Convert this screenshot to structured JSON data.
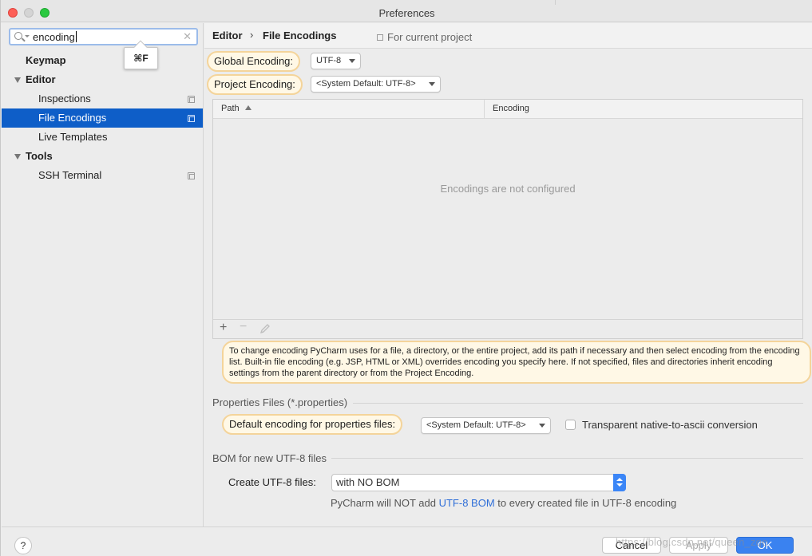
{
  "window": {
    "title": "Preferences"
  },
  "sidebar": {
    "search": {
      "value": "encoding",
      "shortcut": "⌘F"
    },
    "items": [
      {
        "label": "Keymap"
      },
      {
        "label": "Editor"
      },
      {
        "label": "Inspections"
      },
      {
        "label": "File Encodings"
      },
      {
        "label": "Live Templates"
      },
      {
        "label": "Tools"
      },
      {
        "label": "SSH Terminal"
      }
    ]
  },
  "header": {
    "breadcrumb": [
      "Editor",
      "File Encodings"
    ],
    "separator": "›",
    "scope": "For current project"
  },
  "encodings": {
    "global_label": "Global Encoding:",
    "global_value": "UTF-8",
    "project_label": "Project Encoding:",
    "project_value": "<System Default: UTF-8>"
  },
  "table": {
    "columns": [
      "Path",
      "Encoding"
    ],
    "empty_message": "Encodings are not configured",
    "toolbar": {
      "add": "+",
      "remove": "−"
    }
  },
  "note": "To change encoding PyCharm uses for a file, a directory, or the entire project, add its path if necessary and then select encoding from the encoding list. Built-in file encoding (e.g. JSP, HTML or XML) overrides encoding you specify here. If not specified, files and directories inherit encoding settings from the parent directory or from the Project Encoding.",
  "properties": {
    "section_title": "Properties Files (*.properties)",
    "default_label": "Default encoding for properties files:",
    "default_value": "<System Default: UTF-8>",
    "transparent_label": "Transparent native-to-ascii conversion",
    "transparent_checked": false
  },
  "bom": {
    "section_title": "BOM for new UTF-8 files",
    "create_label": "Create UTF-8 files:",
    "create_value": "with NO BOM",
    "note_before": "PyCharm will NOT add",
    "note_link": "UTF-8 BOM",
    "note_after": "to every created file in UTF-8 encoding"
  },
  "footer": {
    "help": "?",
    "cancel": "Cancel",
    "apply": "Apply",
    "ok": "OK",
    "watermark": "https://blog.csdn.net/queen_zqe"
  },
  "colors": {
    "selection": "#0e5ec8",
    "highlight_fill": "#fff8e6",
    "highlight_border": "#f4d49a",
    "primary_button": "#3a82f0",
    "link": "#2f6fd8"
  }
}
